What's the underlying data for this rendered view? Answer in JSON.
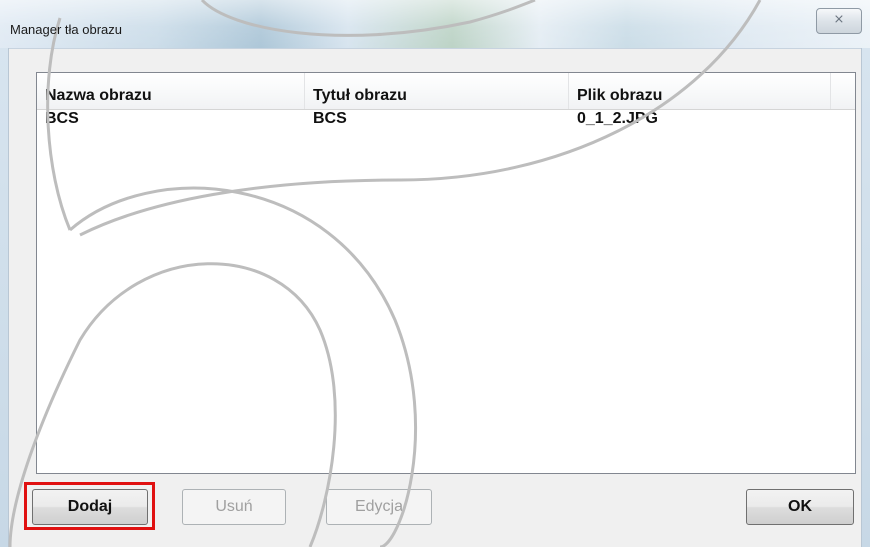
{
  "window": {
    "title": "Manager tła obrazu",
    "close_symbol": "⨯"
  },
  "list": {
    "columns": [
      "Nazwa obrazu",
      "Tytuł obrazu",
      "Plik obrazu"
    ],
    "rows": [
      {
        "name": "BCS",
        "title": "BCS",
        "file": "0_1_2.JPG"
      }
    ]
  },
  "buttons": {
    "add": "Dodaj",
    "remove": "Usuń",
    "edit": "Edycja",
    "ok": "OK"
  },
  "highlight_color": "#e01010"
}
